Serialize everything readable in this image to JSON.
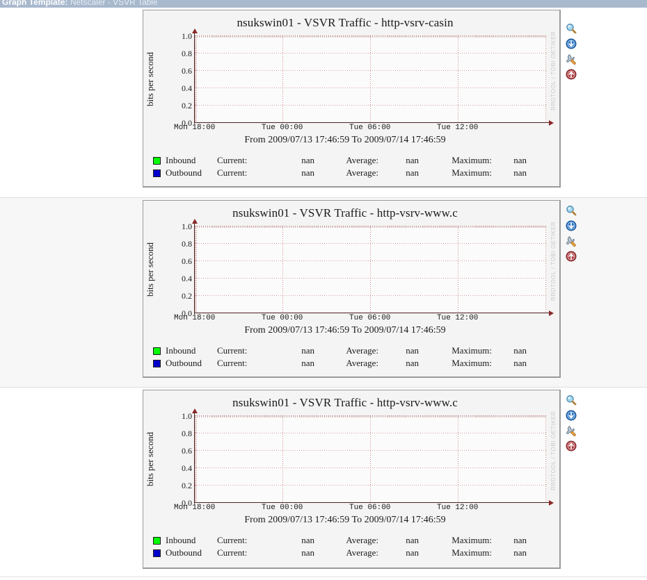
{
  "header": {
    "label": "Graph Template:",
    "value": "Netscaler - VSVR Table"
  },
  "icons": {
    "zoom": "magnifier-icon",
    "page_down": "arrow-down-circle-icon",
    "properties": "wrench-icon",
    "page_up": "arrow-up-circle-icon"
  },
  "watermark": "RRDTOOL / TOBI OETIKER",
  "graphs": [
    {
      "title": "nsukswin01 - VSVR Traffic - http-vsrv-casin",
      "range": "From 2009/07/13 17:46:59 To 2009/07/14 17:46:59",
      "ylabel": "bits per second",
      "legend": [
        {
          "name": "Inbound",
          "color": "#00ff00",
          "current_label": "Current:",
          "current": "nan",
          "average_label": "Average:",
          "average": "nan",
          "maximum_label": "Maximum:",
          "maximum": "nan"
        },
        {
          "name": "Outbound",
          "color": "#0000cc",
          "current_label": "Current:",
          "current": "nan",
          "average_label": "Average:",
          "average": "nan",
          "maximum_label": "Maximum:",
          "maximum": "nan"
        }
      ]
    },
    {
      "title": "nsukswin01 - VSVR Traffic - http-vsrv-www.c",
      "range": "From 2009/07/13 17:46:59 To 2009/07/14 17:46:59",
      "ylabel": "bits per second",
      "legend": [
        {
          "name": "Inbound",
          "color": "#00ff00",
          "current_label": "Current:",
          "current": "nan",
          "average_label": "Average:",
          "average": "nan",
          "maximum_label": "Maximum:",
          "maximum": "nan"
        },
        {
          "name": "Outbound",
          "color": "#0000cc",
          "current_label": "Current:",
          "current": "nan",
          "average_label": "Average:",
          "average": "nan",
          "maximum_label": "Maximum:",
          "maximum": "nan"
        }
      ]
    },
    {
      "title": "nsukswin01 - VSVR Traffic - http-vsrv-www.c",
      "range": "From 2009/07/13 17:46:59 To 2009/07/14 17:46:59",
      "ylabel": "bits per second",
      "legend": [
        {
          "name": "Inbound",
          "color": "#00ff00",
          "current_label": "Current:",
          "current": "nan",
          "average_label": "Average:",
          "average": "nan",
          "maximum_label": "Maximum:",
          "maximum": "nan"
        },
        {
          "name": "Outbound",
          "color": "#0000cc",
          "current_label": "Current:",
          "current": "nan",
          "average_label": "Average:",
          "average": "nan",
          "maximum_label": "Maximum:",
          "maximum": "nan"
        }
      ]
    }
  ],
  "chart_data": {
    "type": "line",
    "title": "nsukswin01 - VSVR Traffic - http-vsrv-casin",
    "xlabel": "",
    "ylabel": "bits per second",
    "ylim": [
      0.0,
      1.0
    ],
    "yticks": [
      0.0,
      0.2,
      0.4,
      0.6,
      0.8,
      1.0
    ],
    "ytick_labels": [
      "0.0",
      "0.2",
      "0.4",
      "0.6",
      "0.8",
      "1.0"
    ],
    "xticks": [
      "Mon 18:00",
      "Tue 00:00",
      "Tue 06:00",
      "Tue 12:00"
    ],
    "x_range": "From 2009/07/13 17:46:59 To 2009/07/14 17:46:59",
    "grid": true,
    "legend_position": "below",
    "series": [
      {
        "name": "Inbound",
        "color": "#00ff00",
        "values": [],
        "current": "nan",
        "average": "nan",
        "maximum": "nan"
      },
      {
        "name": "Outbound",
        "color": "#0000cc",
        "values": [],
        "current": "nan",
        "average": "nan",
        "maximum": "nan"
      }
    ]
  }
}
